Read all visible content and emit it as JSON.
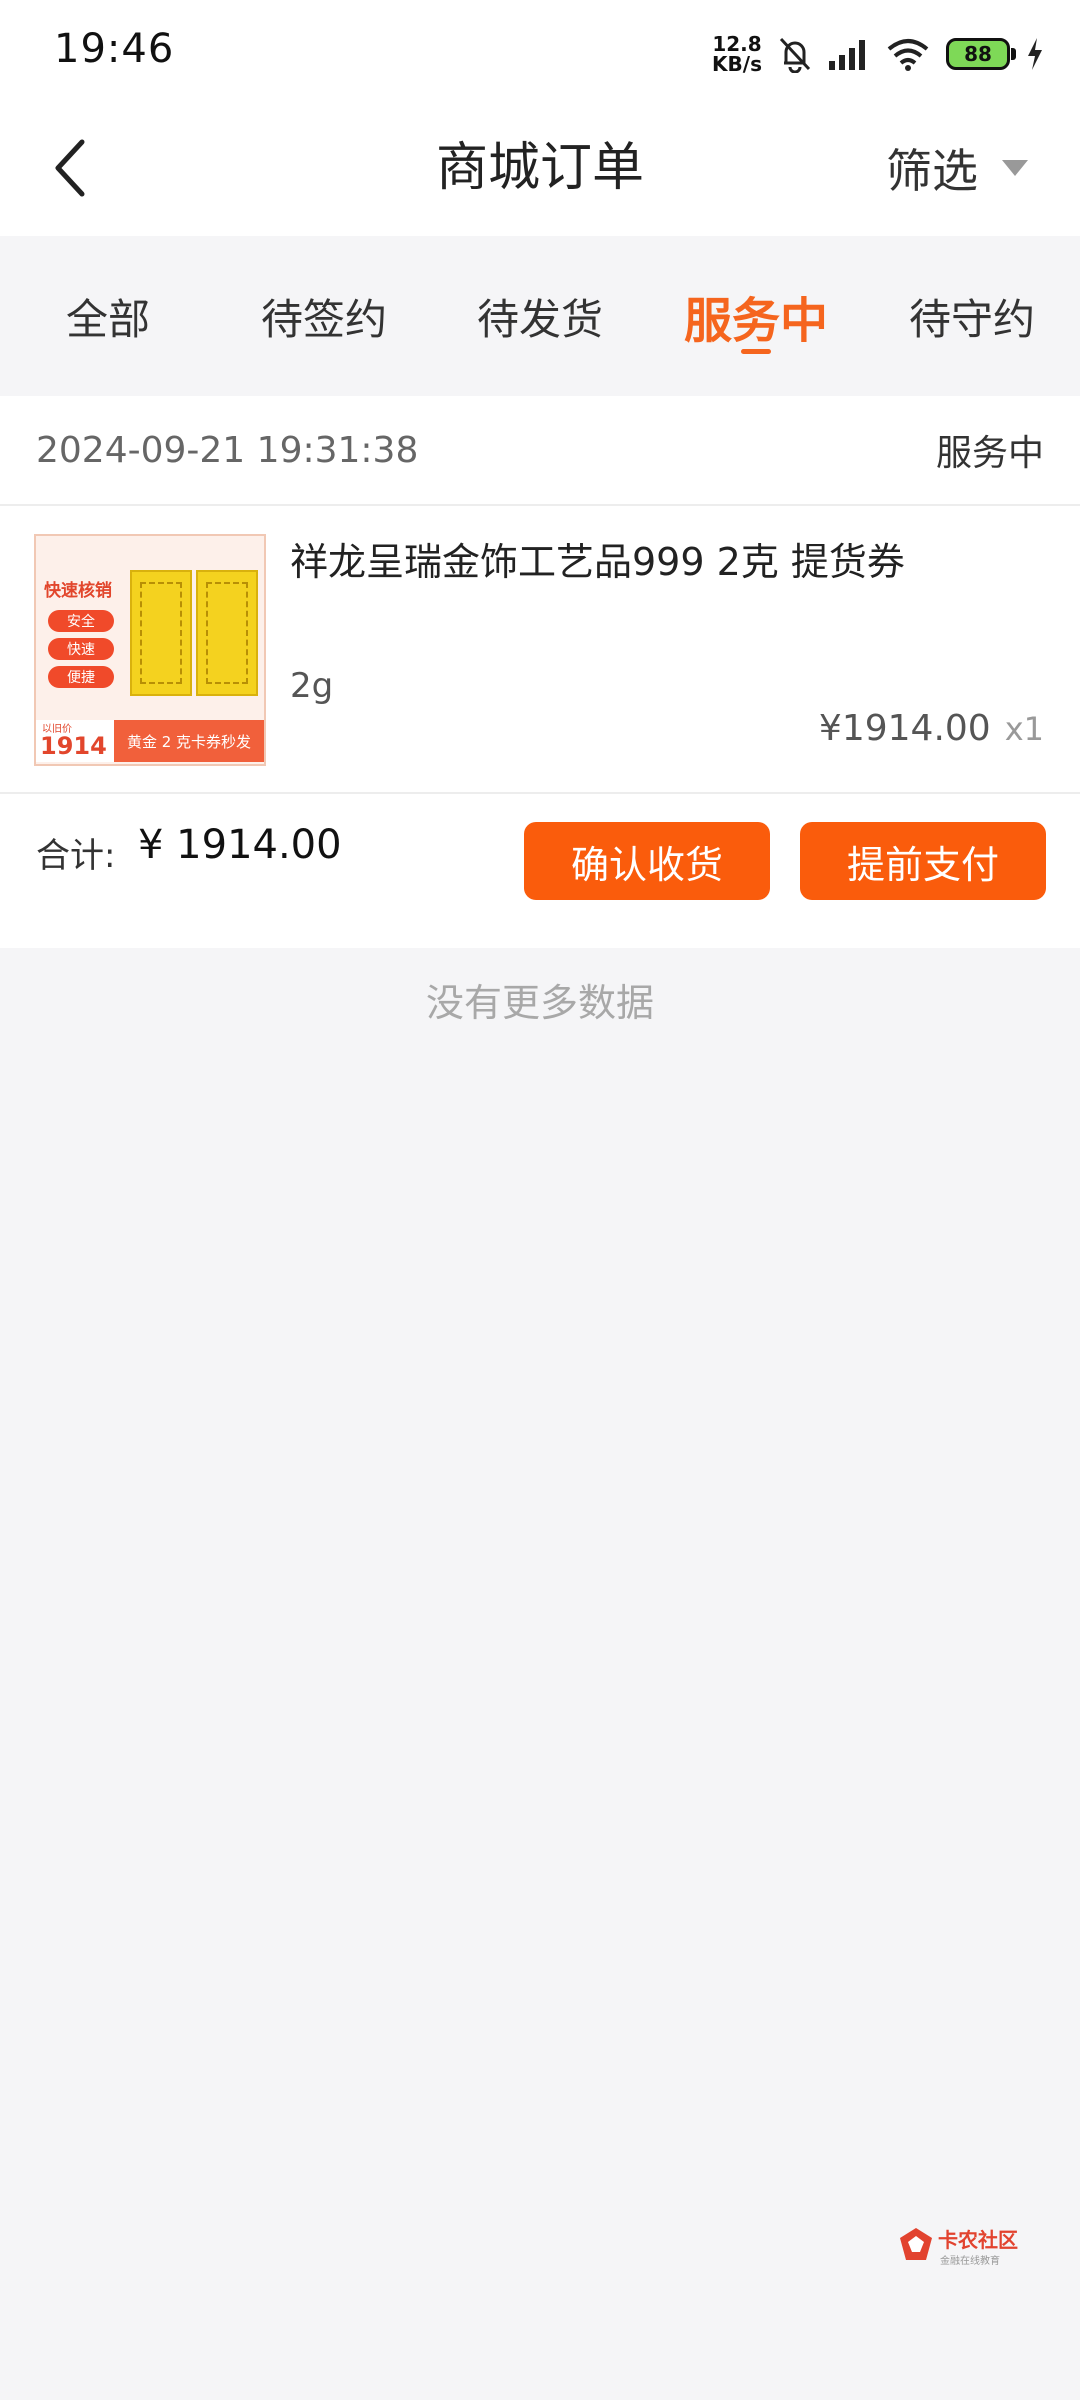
{
  "status_bar": {
    "time": "19:46",
    "net_speed_value": "12.8",
    "net_speed_unit": "KB/s",
    "battery": "88"
  },
  "header": {
    "title": "商城订单",
    "filter_label": "筛选"
  },
  "tabs": [
    {
      "label": "全部",
      "active": false
    },
    {
      "label": "待签约",
      "active": false
    },
    {
      "label": "待发货",
      "active": false
    },
    {
      "label": "服务中",
      "active": true
    },
    {
      "label": "待守约",
      "active": false
    }
  ],
  "order": {
    "time": "2024-09-21 19:31:38",
    "status": "服务中",
    "product": {
      "name": "祥龙呈瑞金饰工艺品999 2克 提货券",
      "spec": "2g",
      "price": "¥1914.00",
      "quantity": "x1",
      "image": {
        "heading": "快速核销",
        "pills": [
          "安全",
          "快速",
          "便捷"
        ],
        "price_small": "以旧价",
        "price": "1914",
        "banner": "黄金 2 克卡券秒发"
      }
    },
    "total_label": "合计:",
    "total_value": "¥ 1914.00",
    "confirm_button": "确认收货",
    "pay_button": "提前支付"
  },
  "footer": {
    "no_more": "没有更多数据"
  },
  "watermark": {
    "text": "卡农社区",
    "sub": "金融在线教育"
  },
  "colors": {
    "accent": "#f5651e",
    "button": "#fa5c0c",
    "background": "#f5f5f7"
  },
  "icons": {
    "back": "back-icon",
    "filter": "triangle-down-icon",
    "mute": "bell-off-icon",
    "signal": "signal-icon",
    "wifi": "wifi-icon",
    "charging": "lightning-icon"
  }
}
